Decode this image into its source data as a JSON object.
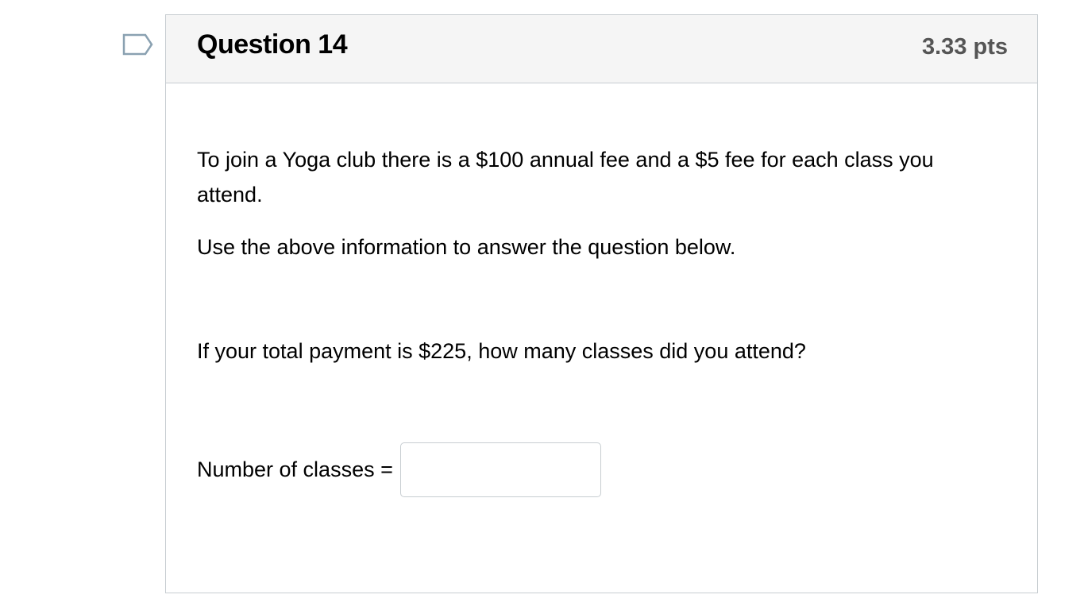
{
  "flag": {
    "icon": "bookmark-flag-icon",
    "color": "#8aa1b1"
  },
  "question": {
    "title": "Question 14",
    "points": "3.33 pts",
    "paragraphs": [
      "To join a Yoga club there is a $100 annual fee and a $5 fee for each class you attend.",
      "Use the above information to answer the question below.",
      "If your total payment is $225, how many classes did you attend?"
    ],
    "answer": {
      "label": "Number of classes =",
      "value": "",
      "placeholder": ""
    }
  }
}
